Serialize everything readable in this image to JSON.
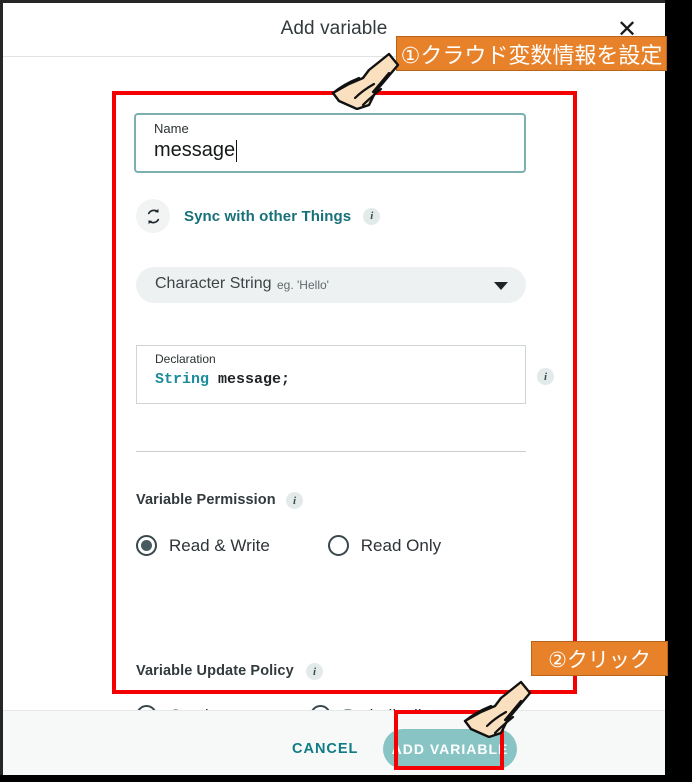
{
  "window": {
    "title": "Add variable",
    "close_icon": "close-icon"
  },
  "form": {
    "name_field": {
      "label": "Name",
      "value": "message",
      "placeholder": "Name"
    },
    "sync": {
      "icon": "sync-icon",
      "label": "Sync with other Things",
      "info_icon": "info-icon"
    },
    "type_select": {
      "value": "Character String",
      "hint": "eg. 'Hello'",
      "caret_icon": "chevron-down-icon"
    },
    "declaration": {
      "label": "Declaration",
      "keyword": "String",
      "identifier": " message;",
      "info_icon": "info-icon"
    },
    "variable_permission": {
      "heading": "Variable Permission",
      "info_icon": "info-icon",
      "options": [
        {
          "label": "Read & Write",
          "selected": true
        },
        {
          "label": "Read Only",
          "selected": false
        }
      ]
    },
    "variable_update_policy": {
      "heading": "Variable Update Policy",
      "info_icon": "info-icon",
      "options": [
        {
          "label": "On change",
          "selected": true
        },
        {
          "label": "Periodically",
          "selected": false
        }
      ]
    }
  },
  "footer": {
    "cancel_label": "CANCEL",
    "add_variable_label": "ADD VARIABLE"
  },
  "annotations": {
    "step1_text": "①クラウド変数情報を設定",
    "step2_text": "②クリック",
    "highlight_color": "#f40000",
    "callout_color": "#e7822a"
  },
  "colors": {
    "accent_teal": "#17707a",
    "button_teal": "#88c4c4",
    "field_border_teal": "#7cb0b0",
    "radio_dark": "#475c61"
  }
}
